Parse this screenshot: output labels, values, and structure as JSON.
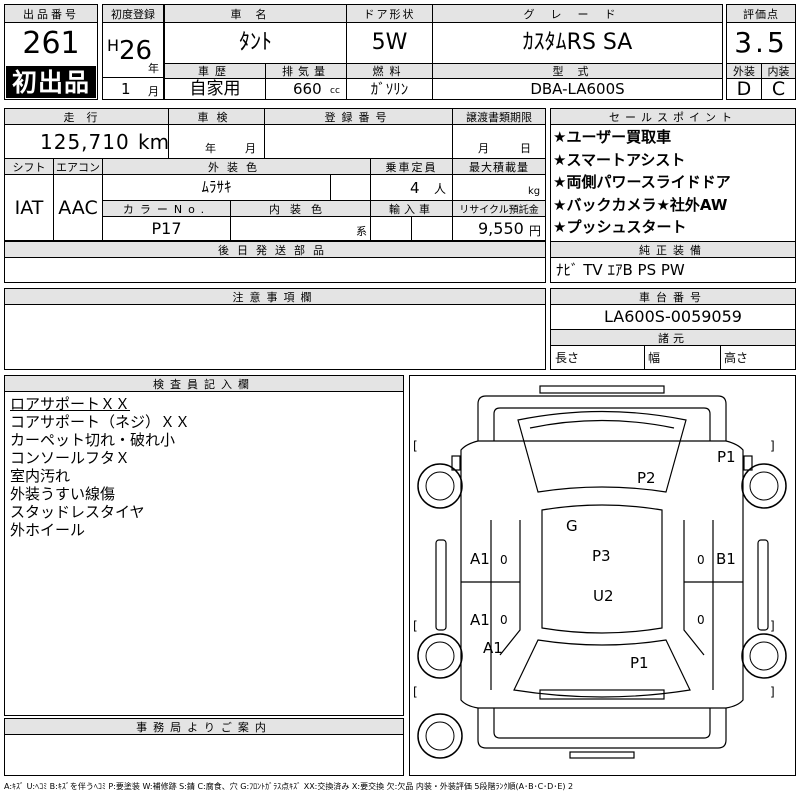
{
  "header": {
    "lot_number_label": "出品番号",
    "lot_number": "261",
    "first_listing_badge": "初出品",
    "first_reg_label": "初度登録",
    "era": "H",
    "year": "26",
    "year_unit": "年",
    "month": "1",
    "month_unit": "月",
    "car_name_label": "車名",
    "car_name": "ﾀﾝﾄ",
    "history_label": "車歴",
    "history": "自家用",
    "displacement_label": "排気量",
    "displacement": "660",
    "displacement_unit": "cc",
    "doors_label": "ドア形状",
    "doors": "5W",
    "fuel_label": "燃料",
    "fuel": "ｶﾞｿﾘﾝ",
    "grade_label": "グレード",
    "grade": "ｶｽﾀﾑRS SA",
    "model_code_label": "型式",
    "model_code": "DBA-LA600S",
    "score_label": "評価点",
    "score": "3.5",
    "exterior_label": "外装",
    "exterior_grade": "D",
    "interior_label": "内装",
    "interior_grade": "C"
  },
  "vehicle": {
    "mileage_label": "走行",
    "mileage": "125,710",
    "mileage_unit": "km",
    "inspection_label": "車検",
    "inspection_year_unit": "年",
    "inspection_month_unit": "月",
    "reg_no_label": "登録番号",
    "transfer_label": "譲渡書類期限",
    "transfer_month_unit": "月",
    "transfer_day_unit": "日",
    "shift_label": "シフト",
    "shift": "IAT",
    "ac_label": "エアコン",
    "ac": "AAC",
    "ext_color_label": "外装色",
    "ext_color": "ﾑﾗｻｷ",
    "capacity_label": "乗車定員",
    "capacity": "4",
    "capacity_unit": "人",
    "max_load_label": "最大積載量",
    "max_load_unit": "kg",
    "color_no_label": "カラーNo.",
    "color_no": "P17",
    "int_color_label": "内装色",
    "int_color_suffix": "系",
    "import_label": "輸入車",
    "recycle_label": "リサイクル預託金",
    "recycle": "9,550",
    "recycle_unit": "円",
    "later_parts_label": "後日発送部品"
  },
  "sales_points": {
    "label": "セールスポイント",
    "items": [
      "★ユーザー買取車",
      "★スマートアシスト",
      "★両側パワースライドドア",
      "★バックカメラ★社外AW",
      "★プッシュスタート"
    ]
  },
  "equipment": {
    "label": "純正装備",
    "value": "ﾅﾋﾞ TV ｴｱB PS PW"
  },
  "notes": {
    "label": "注意事項欄"
  },
  "chassis": {
    "label": "車台番号",
    "value": "LA600S-0059059"
  },
  "specs": {
    "label": "諸元",
    "length_label": "長さ",
    "width_label": "幅",
    "height_label": "高さ"
  },
  "inspector": {
    "label": "検査員記入欄",
    "lines": [
      "ロアサポートＸＸ",
      "コアサポート（ネジ）ＸＸ",
      "カーペット切れ・破れ小",
      "コンソールフタＸ",
      "室内汚れ",
      "外装うすい線傷",
      "スタッドレスタイヤ",
      "外ホイール"
    ]
  },
  "office": {
    "label": "事務局よりご案内"
  },
  "diagram": {
    "marks": {
      "p1_front_right": "P1",
      "p2": "P2",
      "g": "G",
      "p3": "P3",
      "u2": "U2",
      "a1_left_front_door": "A1",
      "a1_left_rear_door": "A1",
      "a1_left_rear": "A1",
      "b1_right_front_door": "B1",
      "p1_rear": "P1"
    },
    "side_zero": "0",
    "bracket_left": "[",
    "bracket_right": "]"
  },
  "legend": "A:ｷｽﾞ U:ﾍｺﾐ B:ｷｽﾞを伴うﾍｺﾐ P:要塗装 W:補修跡 S:錆 C:腐食、穴 G:ﾌﾛﾝﾄｶﾞﾗｽ点ｷｽﾞ XX:交換済み X:要交換 欠:欠品 内装・外装評価 5段階ﾗﾝｸ順(A･B･C･D･E) 2"
}
